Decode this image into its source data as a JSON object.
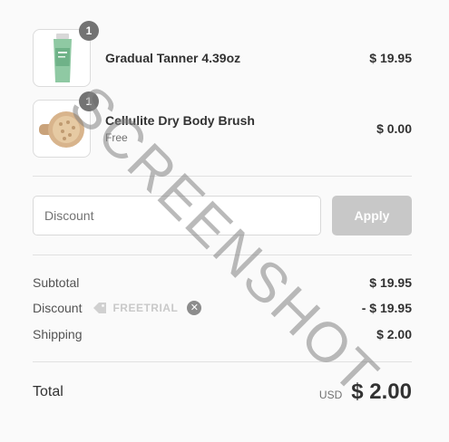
{
  "colors": {
    "badge_bg": "#737373",
    "apply_button_bg": "#c8c8c8",
    "divider": "#e1e1e1",
    "text_primary": "#323232",
    "text_secondary": "#717171"
  },
  "cart": {
    "items": [
      {
        "title": "Gradual Tanner 4.39oz",
        "variant": "",
        "price": "$ 19.95",
        "quantity": "1",
        "image_icon": "tanner-tube-icon"
      },
      {
        "title": "Cellulite Dry Body Brush",
        "variant": "Free",
        "price": "$ 0.00",
        "quantity": "1",
        "image_icon": "body-brush-icon"
      }
    ]
  },
  "discount": {
    "placeholder": "Discount",
    "value": "",
    "apply_label": "Apply"
  },
  "summary": {
    "subtotal_label": "Subtotal",
    "subtotal_value": "$ 19.95",
    "discount_label": "Discount",
    "discount_code": "FREETRIAL",
    "discount_value": "- $ 19.95",
    "shipping_label": "Shipping",
    "shipping_value": "$ 2.00"
  },
  "total": {
    "label": "Total",
    "currency": "USD",
    "amount": "$ 2.00"
  },
  "watermark": "SCREENSHOT"
}
